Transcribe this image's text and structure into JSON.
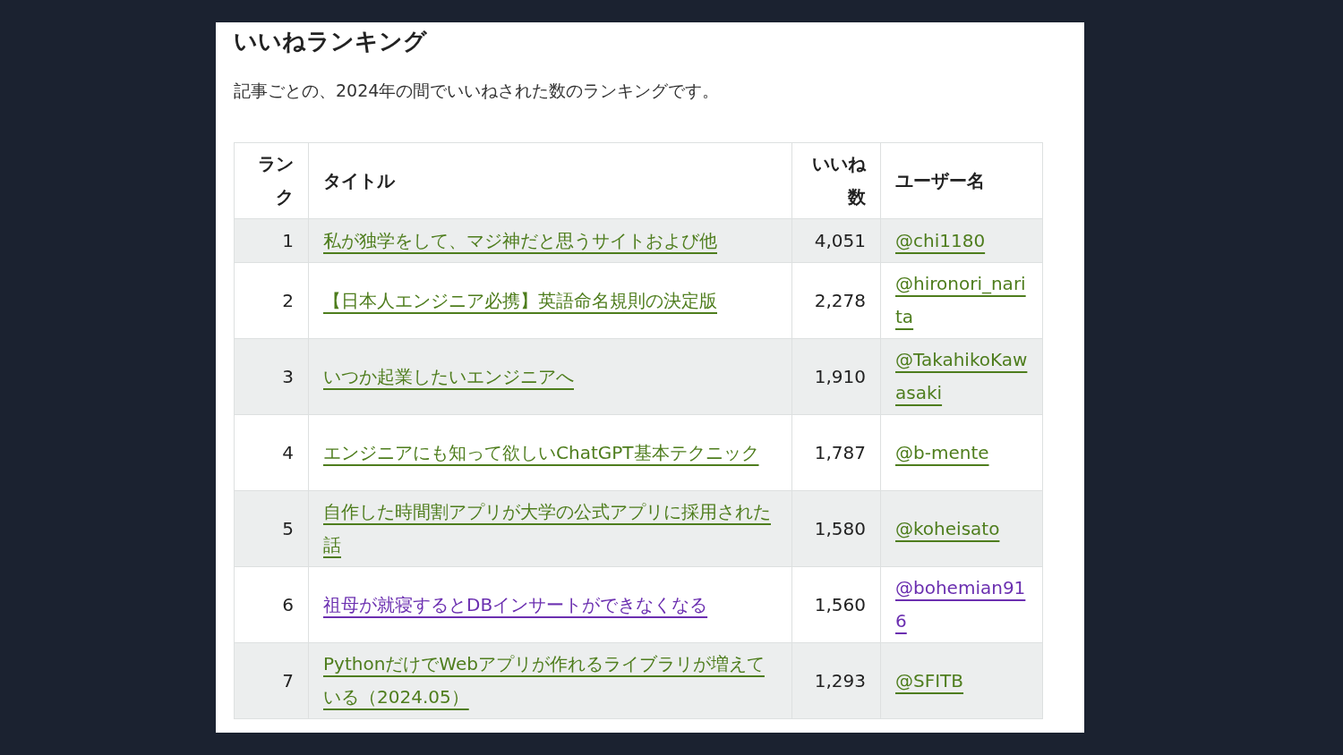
{
  "heading": "いいねランキング",
  "description": "記事ごとの、2024年の間でいいねされた数のランキングです。",
  "table": {
    "columns": [
      "ランク",
      "タイトル",
      "いいね数",
      "ユーザー名"
    ],
    "rows": [
      {
        "rank": "1",
        "title": "私が独学をして、マジ神だと思うサイトおよび他",
        "likes": "4,051",
        "user": "@chi1180",
        "visited": false
      },
      {
        "rank": "2",
        "title": "【日本人エンジニア必携】英語命名規則の決定版",
        "likes": "2,278",
        "user": "@hironori_narita",
        "visited": false
      },
      {
        "rank": "3",
        "title": "いつか起業したいエンジニアへ",
        "likes": "1,910",
        "user": "@TakahikoKawasaki",
        "visited": false
      },
      {
        "rank": "4",
        "title": "エンジニアにも知って欲しいChatGPT基本テクニック",
        "likes": "1,787",
        "user": "@b-mente",
        "visited": false
      },
      {
        "rank": "5",
        "title": "自作した時間割アプリが大学の公式アプリに採用された話",
        "likes": "1,580",
        "user": "@koheisato",
        "visited": false
      },
      {
        "rank": "6",
        "title": "祖母が就寝するとDBインサートができなくなる",
        "likes": "1,560",
        "user": "@bohemian916",
        "visited": true
      },
      {
        "rank": "7",
        "title": "PythonだけでWebアプリが作れるライブラリが増えている（2024.05）",
        "likes": "1,293",
        "user": "@SFITB",
        "visited": false
      }
    ]
  }
}
